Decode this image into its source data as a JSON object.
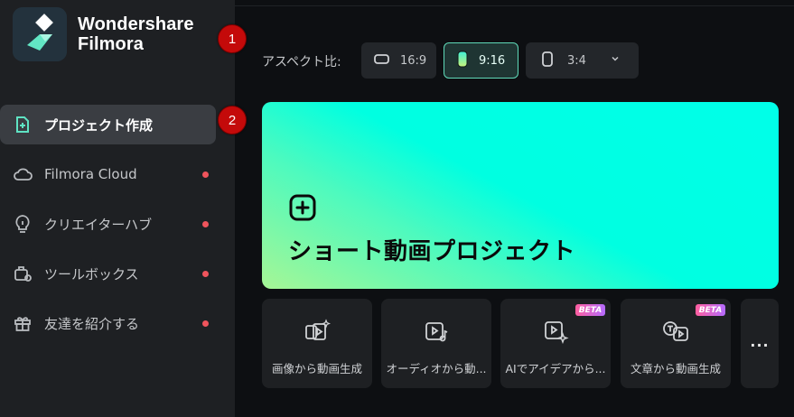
{
  "app": {
    "brand_line1": "Wondershare",
    "brand_line2": "Filmora"
  },
  "sidebar": {
    "items": [
      {
        "label": "プロジェクト作成",
        "icon": "new-project-icon",
        "active": true,
        "dot": false
      },
      {
        "label": "Filmora Cloud",
        "icon": "cloud-icon",
        "active": false,
        "dot": true
      },
      {
        "label": "クリエイターハブ",
        "icon": "lightbulb-icon",
        "active": false,
        "dot": true
      },
      {
        "label": "ツールボックス",
        "icon": "toolbox-icon",
        "active": false,
        "dot": true
      },
      {
        "label": "友達を紹介する",
        "icon": "gift-icon",
        "active": false,
        "dot": true
      }
    ]
  },
  "annotations": {
    "badge1": "1",
    "badge2": "2"
  },
  "aspect": {
    "label": "アスペクト比:",
    "options": [
      {
        "label": "16:9",
        "icon": "landscape-ratio-icon",
        "selected": false
      },
      {
        "label": "9:16",
        "icon": "portrait-ratio-icon",
        "selected": true
      },
      {
        "label": "3:4",
        "icon": "portrait-3-4-icon",
        "selected": false,
        "dropdown": true
      }
    ]
  },
  "hero": {
    "title": "ショート動画プロジェクト",
    "icon": "plus-square-icon"
  },
  "tools": [
    {
      "label": "画像から動画生成",
      "icon": "image-to-video-icon",
      "beta": false
    },
    {
      "label": "オーディオから動...",
      "icon": "audio-to-video-icon",
      "beta": false
    },
    {
      "label": "AIでアイデアから...",
      "icon": "ai-idea-video-icon",
      "beta": true,
      "beta_text": "BETA"
    },
    {
      "label": "文章から動画生成",
      "icon": "text-to-video-icon",
      "beta": true,
      "beta_text": "BETA"
    }
  ],
  "more_label": "...",
  "colors": {
    "accent": "#5fd9b8",
    "dot": "#f0545c",
    "badge": "#c40a0a",
    "hero_start": "#00ffe9",
    "hero_end": "#a6f695"
  }
}
